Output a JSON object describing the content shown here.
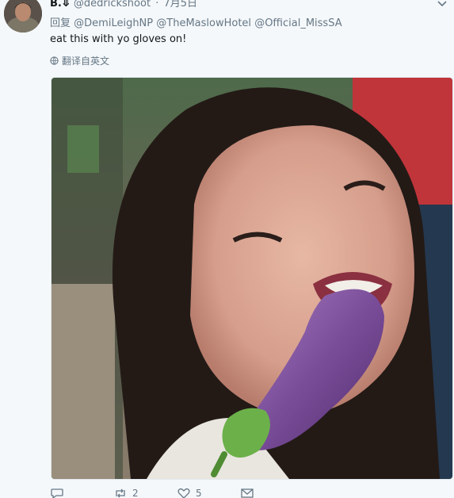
{
  "tweet": {
    "display_name": "B.⤋",
    "handle": "@dedrickshoot",
    "separator": "·",
    "date": "7月5日",
    "reply_prefix": "回复",
    "mentions": [
      "@DemiLeighNP",
      "@TheMaslowHotel",
      "@Official_MissSA"
    ],
    "text": "eat this with yo gloves on!",
    "translate_label": "翻译自英文"
  },
  "actions": {
    "reply_count": "",
    "retweet_count": "2",
    "like_count": "5"
  },
  "icons": {
    "globe": "globe-icon",
    "chevron": "chevron-down-icon",
    "reply": "reply-icon",
    "retweet": "retweet-icon",
    "like": "heart-icon",
    "dm": "envelope-icon"
  },
  "colors": {
    "background": "#f5f8fa",
    "text": "#14171a",
    "muted": "#657786"
  }
}
